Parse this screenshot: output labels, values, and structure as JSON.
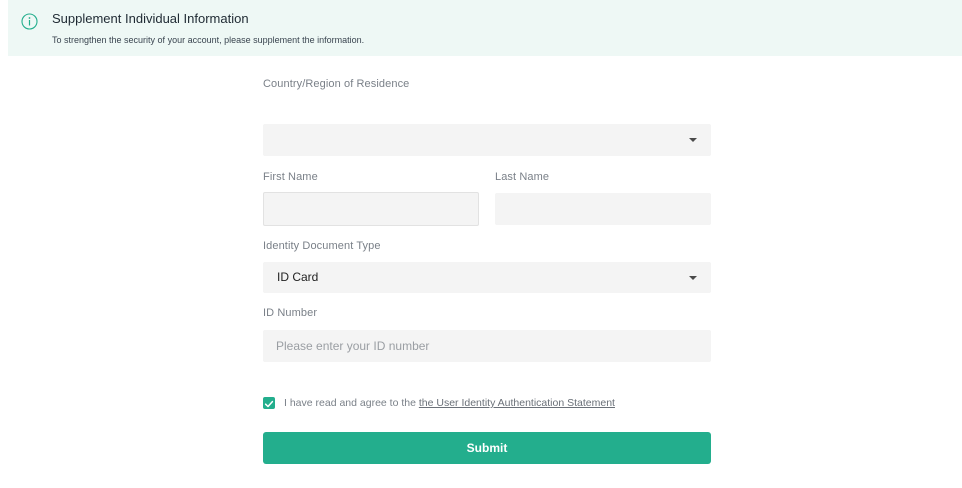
{
  "banner": {
    "title": "Supplement Individual Information",
    "subtitle": "To strengthen the security of your account, please supplement the information.",
    "icon": "info-icon",
    "background": "#eef8f5",
    "icon_color": "#23ae8d"
  },
  "form": {
    "country": {
      "label": "Country/Region of Residence",
      "value": ""
    },
    "first_name": {
      "label": "First Name",
      "value": ""
    },
    "last_name": {
      "label": "Last Name",
      "value": ""
    },
    "document_type": {
      "label": "Identity Document Type",
      "value": "ID Card"
    },
    "id_number": {
      "label": "ID Number",
      "value": "",
      "placeholder": "Please enter your ID number"
    },
    "agreement": {
      "checked": true,
      "text": "I have read and agree to the",
      "link_text": "the User Identity Authentication Statement"
    },
    "submit_label": "Submit"
  },
  "colors": {
    "accent": "#23ae8d",
    "field_bg": "#f4f4f4",
    "label": "#7a8088"
  }
}
